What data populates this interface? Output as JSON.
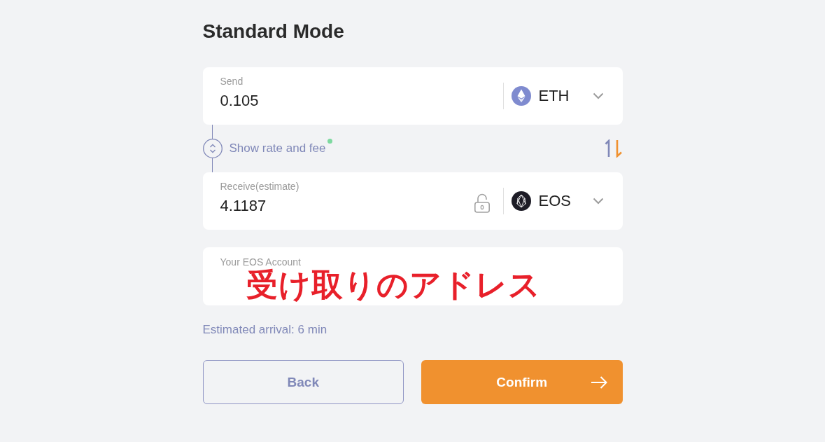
{
  "title": "Standard Mode",
  "send": {
    "label": "Send",
    "value": "0.105",
    "currency": "ETH"
  },
  "rate_toggle": {
    "label": "Show rate and fee",
    "notification": true
  },
  "receive": {
    "label": "Receive(estimate)",
    "value": "4.1187",
    "currency": "EOS",
    "locked": false
  },
  "account": {
    "label": "Your EOS Account"
  },
  "annotation": "受け取りのアドレス",
  "estimated_arrival": "Estimated arrival: 6 min",
  "buttons": [
    {
      "label": "Back",
      "kind": "secondary"
    },
    {
      "label": "Confirm",
      "kind": "primary"
    }
  ]
}
